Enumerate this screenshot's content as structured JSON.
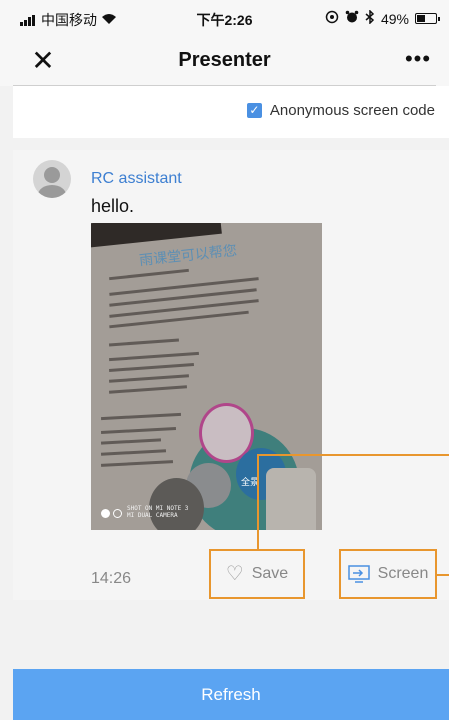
{
  "status_bar": {
    "carrier": "中国移动",
    "time": "下午2:26",
    "battery": "49%",
    "battery_level": 0.49
  },
  "nav": {
    "title": "Presenter",
    "close_icon": "close-icon",
    "more_icon": "more-icon"
  },
  "options": {
    "anonymous_label": "Anonymous screen code",
    "anonymous_checked": true
  },
  "message": {
    "sender": "RC assistant",
    "text": "hello.",
    "time": "14:26",
    "photo": {
      "heading": "雨课堂可以帮您",
      "watermark": "SHOT ON MI NOTE 3\nMI DUAL CAMERA",
      "center_label": "全景"
    }
  },
  "actions": {
    "save_label": "Save",
    "screen_label": "Screen"
  },
  "refresh_label": "Refresh",
  "colors": {
    "accent": "#5ba4f2",
    "link": "#3d7fd1",
    "highlight_box": "#e8962e"
  }
}
